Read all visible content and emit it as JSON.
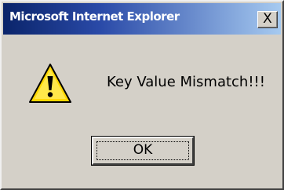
{
  "window": {
    "title": "Microsoft Internet Explorer",
    "close_label": "X"
  },
  "dialog": {
    "icon": "warning-icon",
    "message": "Key Value Mismatch!!!",
    "ok_label": "OK"
  },
  "colors": {
    "titlebar_start": "#0a246a",
    "titlebar_end": "#a6caf0",
    "dialog_background": "#d4d0c8",
    "warning_yellow": "#ffd700"
  }
}
